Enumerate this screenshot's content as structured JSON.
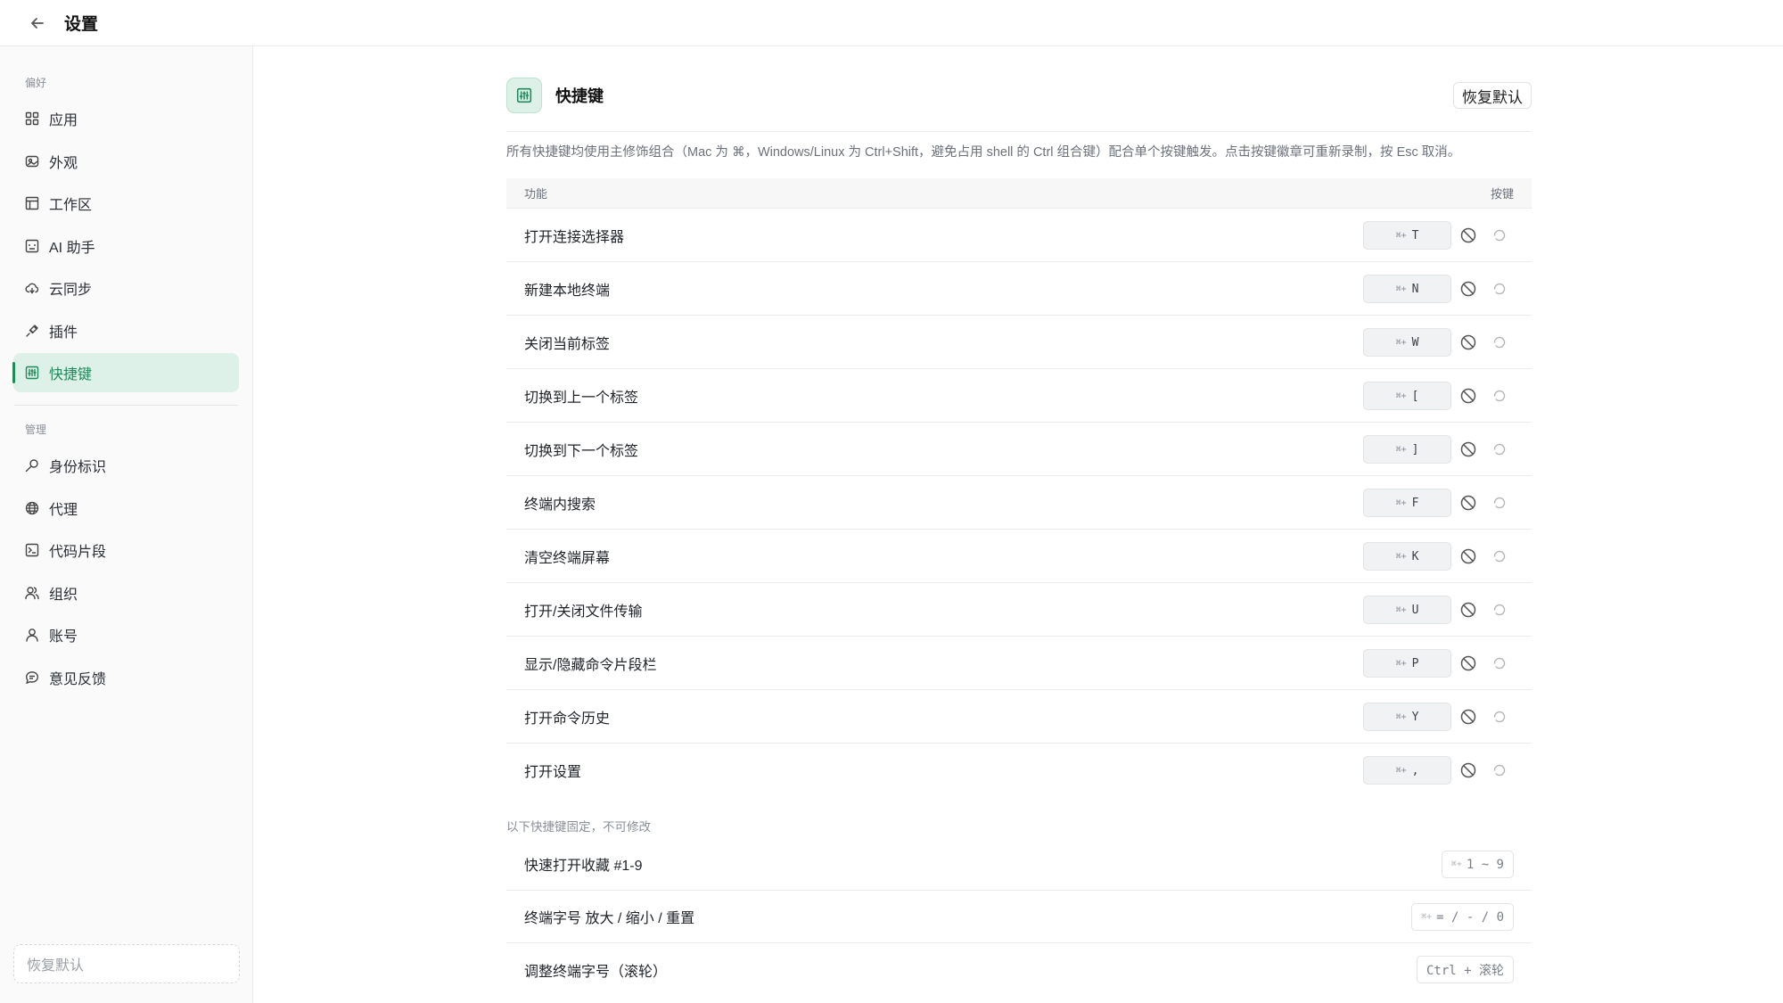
{
  "topbar": {
    "title": "设置",
    "back_icon": "arrow-left-icon"
  },
  "sidebar": {
    "groups": [
      {
        "label": "偏好",
        "items": [
          {
            "label": "应用",
            "icon": "grid-icon"
          },
          {
            "label": "外观",
            "icon": "palette-icon"
          },
          {
            "label": "工作区",
            "icon": "layout-icon"
          },
          {
            "label": "AI 助手",
            "icon": "bot-icon"
          },
          {
            "label": "云同步",
            "icon": "cloud-sync-icon"
          },
          {
            "label": "插件",
            "icon": "plug-icon"
          },
          {
            "label": "快捷键",
            "icon": "keyboard-icon",
            "active": true
          }
        ]
      },
      {
        "label": "管理",
        "items": [
          {
            "label": "身份标识",
            "icon": "key-icon"
          },
          {
            "label": "代理",
            "icon": "globe-icon"
          },
          {
            "label": "代码片段",
            "icon": "terminal-icon"
          },
          {
            "label": "组织",
            "icon": "users-icon"
          },
          {
            "label": "账号",
            "icon": "user-icon"
          },
          {
            "label": "意见反馈",
            "icon": "chat-icon"
          }
        ]
      }
    ],
    "reset_label": "恢复默认"
  },
  "main": {
    "title": "快捷键",
    "reset_button": "恢复默认",
    "description": "所有快捷键均使用主修饰组合（Mac 为 ⌘，Windows/Linux 为 Ctrl+Shift，避免占用 shell 的 Ctrl 组合键）配合单个按键触发。点击按键徽章可重新录制，按 Esc 取消。",
    "columns": {
      "function": "功能",
      "keys": "按键"
    },
    "modifier": "⌘+",
    "shortcuts": [
      {
        "label": "打开连接选择器",
        "key": "T"
      },
      {
        "label": "新建本地终端",
        "key": "N"
      },
      {
        "label": "关闭当前标签",
        "key": "W"
      },
      {
        "label": "切换到上一个标签",
        "key": "["
      },
      {
        "label": "切换到下一个标签",
        "key": "]"
      },
      {
        "label": "终端内搜索",
        "key": "F"
      },
      {
        "label": "清空终端屏幕",
        "key": "K"
      },
      {
        "label": "打开/关闭文件传输",
        "key": "U"
      },
      {
        "label": "显示/隐藏命令片段栏",
        "key": "P"
      },
      {
        "label": "打开命令历史",
        "key": "Y"
      },
      {
        "label": "打开设置",
        "key": ","
      }
    ],
    "fixed_note": "以下快捷键固定，不可修改",
    "fixed_shortcuts": [
      {
        "label": "快速打开收藏 #1-9",
        "modifier": "⌘+",
        "key": "1 ~ 9"
      },
      {
        "label": "终端字号 放大 / 缩小 / 重置",
        "modifier": "⌘+",
        "key": "= / - / 0"
      },
      {
        "label": "调整终端字号（滚轮）",
        "modifier": "",
        "key": "Ctrl + 滚轮"
      }
    ]
  }
}
